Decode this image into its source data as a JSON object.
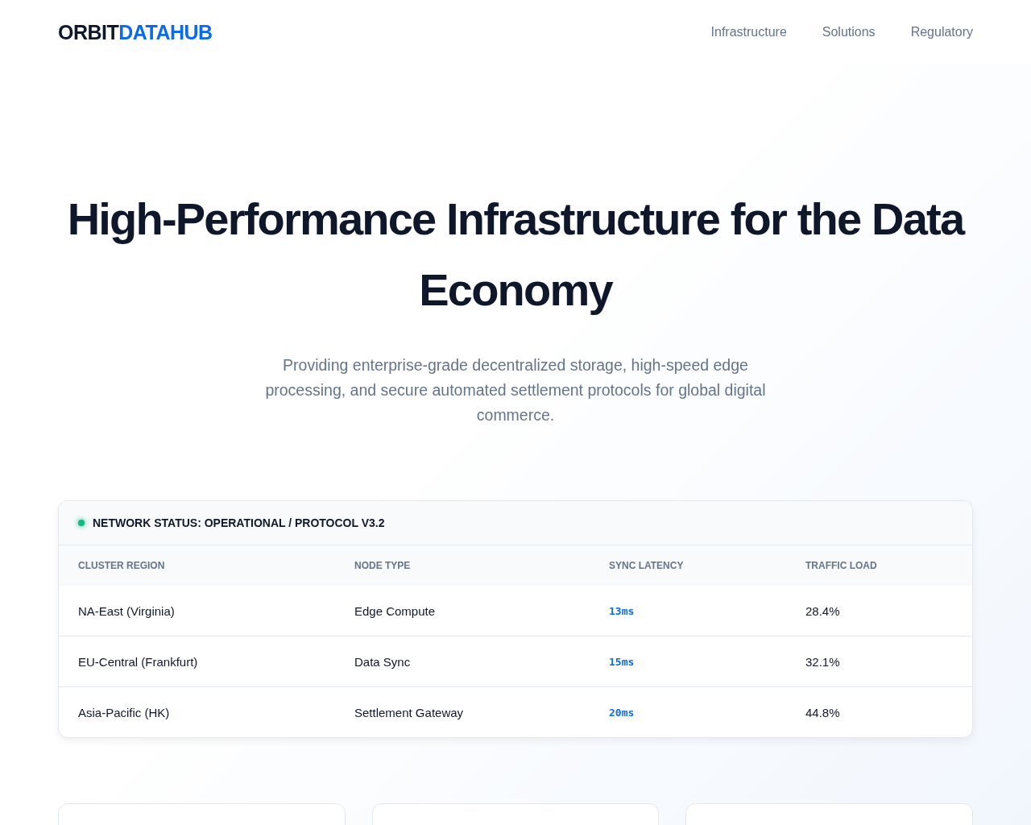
{
  "header": {
    "logo": {
      "part_1": "ORBIT",
      "part_2": "DATAHUB"
    },
    "nav": [
      {
        "label": "Infrastructure"
      },
      {
        "label": "Solutions"
      },
      {
        "label": "Regulatory"
      }
    ]
  },
  "hero": {
    "title": "High-Performance Infrastructure for the Data Economy",
    "subtitle": "Providing enterprise-grade decentralized storage, high-speed edge processing, and secure automated settlement protocols for global digital commerce."
  },
  "status_panel": {
    "title": "NETWORK STATUS: OPERATIONAL / PROTOCOL V3.2",
    "table": {
      "columns": [
        "CLUSTER REGION",
        "NODE TYPE",
        "SYNC LATENCY",
        "TRAFFIC LOAD"
      ],
      "rows": [
        [
          "NA-East (Virginia)",
          "Edge Compute",
          "13ms",
          "28.4%"
        ],
        [
          "EU-Central (Frankfurt)",
          "Data Sync",
          "15ms",
          "32.1%"
        ],
        [
          "Asia-Pacific (HK)",
          "Settlement Gateway",
          "20ms",
          "44.8%"
        ]
      ]
    }
  },
  "feature_cards": [
    {
      "kind": "card"
    },
    {
      "kind": "card"
    },
    {
      "kind": "card"
    }
  ]
}
